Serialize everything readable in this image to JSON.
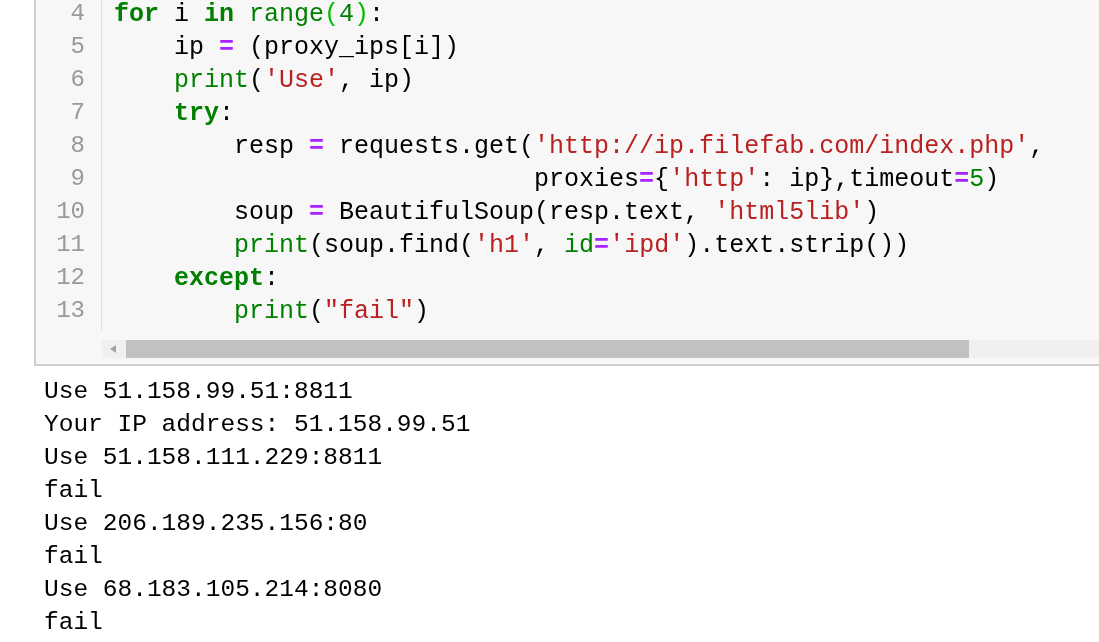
{
  "code_cell": {
    "lines": [
      {
        "number": "4",
        "tokens": [
          {
            "kind": "kw",
            "text": "for"
          },
          {
            "kind": "plain",
            "text": " i "
          },
          {
            "kind": "kw",
            "text": "in"
          },
          {
            "kind": "builtin",
            "text": " range"
          },
          {
            "kind": "bracket",
            "text": "("
          },
          {
            "kind": "num",
            "text": "4"
          },
          {
            "kind": "bracket",
            "text": ")"
          },
          {
            "kind": "plain",
            "text": ":"
          }
        ],
        "children": [
          {
            "number": "5",
            "tokens": [
              {
                "kind": "plain",
                "text": "ip "
              },
              {
                "kind": "op",
                "text": "="
              },
              {
                "kind": "plain",
                "text": " (proxy_ips[i])"
              }
            ]
          },
          {
            "number": "6",
            "tokens": [
              {
                "kind": "builtin",
                "text": "print"
              },
              {
                "kind": "plain",
                "text": "("
              },
              {
                "kind": "str",
                "text": "'Use'"
              },
              {
                "kind": "plain",
                "text": ", ip)"
              }
            ]
          },
          {
            "number": "7",
            "tokens": [
              {
                "kind": "kw",
                "text": "try"
              },
              {
                "kind": "plain",
                "text": ":"
              }
            ],
            "children": [
              {
                "number": "8",
                "tokens": [
                  {
                    "kind": "plain",
                    "text": "resp "
                  },
                  {
                    "kind": "op",
                    "text": "="
                  },
                  {
                    "kind": "plain",
                    "text": " requests.get("
                  },
                  {
                    "kind": "str",
                    "text": "'http://ip.filefab.com/index.php'"
                  },
                  {
                    "kind": "plain",
                    "text": ","
                  }
                ]
              },
              {
                "number": "9",
                "tokens": [
                  {
                    "kind": "plain",
                    "text": "                    proxies"
                  },
                  {
                    "kind": "op",
                    "text": "="
                  },
                  {
                    "kind": "plain",
                    "text": "{"
                  },
                  {
                    "kind": "str",
                    "text": "'http'"
                  },
                  {
                    "kind": "plain",
                    "text": ": ip},timeout"
                  },
                  {
                    "kind": "op",
                    "text": "="
                  },
                  {
                    "kind": "num",
                    "text": "5"
                  },
                  {
                    "kind": "plain",
                    "text": ")"
                  }
                ]
              },
              {
                "number": "10",
                "tokens": [
                  {
                    "kind": "plain",
                    "text": "soup "
                  },
                  {
                    "kind": "op",
                    "text": "="
                  },
                  {
                    "kind": "plain",
                    "text": " BeautifulSoup(resp.text, "
                  },
                  {
                    "kind": "str",
                    "text": "'html5lib'"
                  },
                  {
                    "kind": "plain",
                    "text": ")"
                  }
                ]
              },
              {
                "number": "11",
                "tokens": [
                  {
                    "kind": "builtin",
                    "text": "print"
                  },
                  {
                    "kind": "plain",
                    "text": "(soup.find("
                  },
                  {
                    "kind": "str",
                    "text": "'h1'"
                  },
                  {
                    "kind": "plain",
                    "text": ", "
                  },
                  {
                    "kind": "builtin",
                    "text": "id"
                  },
                  {
                    "kind": "op",
                    "text": "="
                  },
                  {
                    "kind": "str",
                    "text": "'ipd'"
                  },
                  {
                    "kind": "plain",
                    "text": ").text.strip())"
                  }
                ]
              }
            ]
          },
          {
            "number": "12",
            "tokens": [
              {
                "kind": "kw",
                "text": "except"
              },
              {
                "kind": "plain",
                "text": ":"
              }
            ],
            "children": [
              {
                "number": "13",
                "tokens": [
                  {
                    "kind": "builtin",
                    "text": "print"
                  },
                  {
                    "kind": "plain",
                    "text": "("
                  },
                  {
                    "kind": "str",
                    "text": "\"fail\""
                  },
                  {
                    "kind": "plain",
                    "text": ")"
                  }
                ]
              }
            ]
          }
        ]
      }
    ]
  },
  "output": [
    "Use 51.158.99.51:8811",
    "Your IP address: 51.158.99.51",
    "Use 51.158.111.229:8811",
    "fail",
    "Use 206.189.235.156:80",
    "fail",
    "Use 68.183.105.214:8080",
    "fail"
  ]
}
